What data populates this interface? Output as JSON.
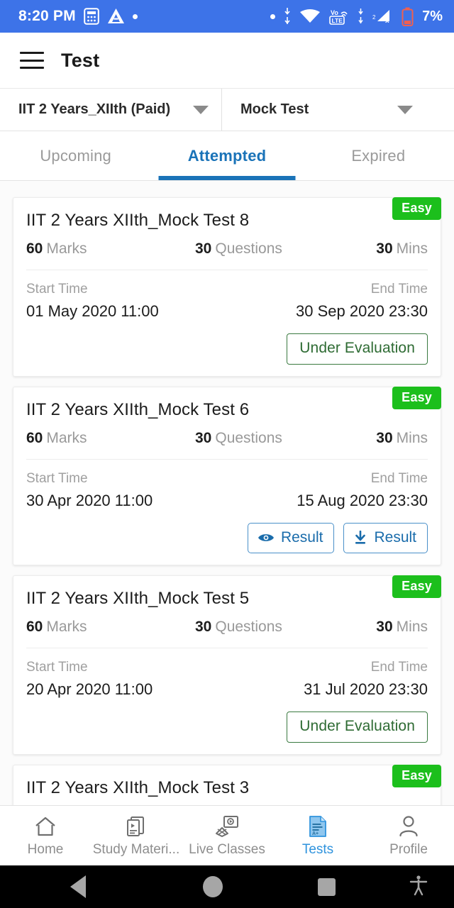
{
  "status_bar": {
    "time": "8:20 PM",
    "battery_percent": "7%",
    "icons": [
      "calculator-icon",
      "app-triangle-icon",
      "notification-dot-icon",
      "data-transfer-icon",
      "wifi-icon",
      "volte-lte-icon",
      "signal-bars-icon",
      "battery-low-icon"
    ],
    "background_color": "#3d73e8"
  },
  "app_bar": {
    "menu_icon": "hamburger-menu-icon",
    "title": "Test"
  },
  "filters": {
    "course": {
      "label": "IIT 2 Years_XIIth (Paid)"
    },
    "test_type": {
      "label": "Mock Test"
    }
  },
  "tabs": {
    "active_color": "#1a73b8",
    "items": [
      {
        "label": "Upcoming",
        "active": false
      },
      {
        "label": "Attempted",
        "active": true
      },
      {
        "label": "Expired",
        "active": false
      }
    ]
  },
  "labels": {
    "start_time": "Start Time",
    "end_time": "End Time",
    "marks": "Marks",
    "questions": "Questions",
    "mins": "Mins"
  },
  "actions": {
    "under_evaluation": "Under Evaluation",
    "view_result": "Result",
    "download_result": "Result"
  },
  "badge_color": "#1cbf1c",
  "cards": [
    {
      "badge": "Easy",
      "title": "IIT 2 Years XIIth_Mock Test 8",
      "marks": "60",
      "questions": "30",
      "mins": "30",
      "start_time": "01 May 2020 11:00",
      "end_time": "30 Sep 2020 23:30",
      "action": "under_evaluation"
    },
    {
      "badge": "Easy",
      "title": "IIT 2 Years XIIth_Mock Test 6",
      "marks": "60",
      "questions": "30",
      "mins": "30",
      "start_time": "30 Apr 2020 11:00",
      "end_time": "15 Aug 2020 23:30",
      "action": "results"
    },
    {
      "badge": "Easy",
      "title": "IIT 2 Years XIIth_Mock Test 5",
      "marks": "60",
      "questions": "30",
      "mins": "30",
      "start_time": "20 Apr 2020 11:00",
      "end_time": "31 Jul 2020 23:30",
      "action": "under_evaluation"
    },
    {
      "badge": "Easy",
      "title": "IIT 2 Years XIIth_Mock Test 3",
      "action": "partial"
    }
  ],
  "bottom_nav": {
    "active_color": "#2f93dd",
    "items": [
      {
        "label": "Home",
        "icon": "home-icon",
        "active": false
      },
      {
        "label": "Study Materi...",
        "icon": "study-material-icon",
        "active": false
      },
      {
        "label": "Live Classes",
        "icon": "live-classes-icon",
        "active": false
      },
      {
        "label": "Tests",
        "icon": "tests-document-icon",
        "active": true
      },
      {
        "label": "Profile",
        "icon": "profile-person-icon",
        "active": false
      }
    ]
  },
  "android_nav": {
    "back": "back-triangle-icon",
    "home": "home-circle-icon",
    "recents": "recents-square-icon",
    "accessibility": "accessibility-icon"
  }
}
